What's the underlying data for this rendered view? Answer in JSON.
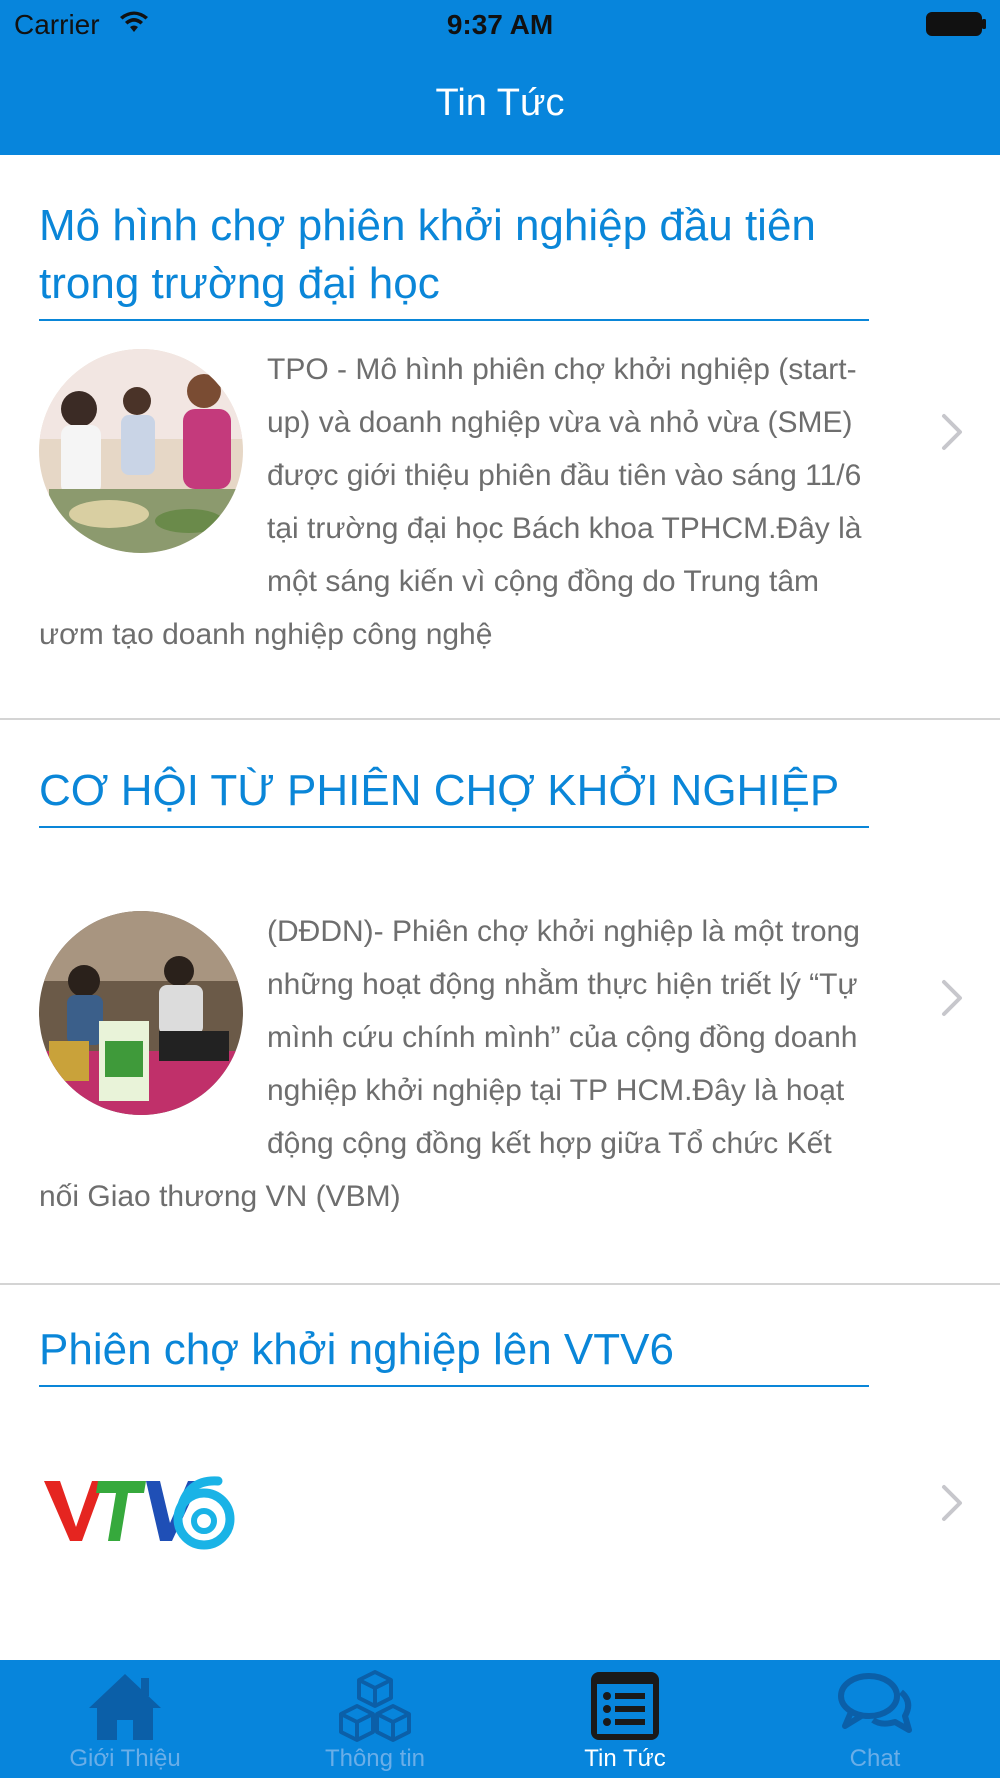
{
  "status_bar": {
    "carrier": "Carrier",
    "time": "9:37 AM"
  },
  "nav": {
    "title": "Tin Tức"
  },
  "news": [
    {
      "title": "Mô hình chợ phiên khởi nghiệp đầu tiên trong trường đại học",
      "summary": "TPO - Mô hình phiên chợ khởi nghiệp (start-up) và doanh nghiệp vừa và nhỏ vừa (SME) được giới thiệu phiên đầu tiên vào sáng 11/6 tại trường đại học Bách khoa TPHCM.Đây là một sáng kiến vì cộng đồng do Trung tâm ươm tạo doanh nghiệp công nghệ"
    },
    {
      "title": "CƠ HỘI TỪ PHIÊN CHỢ KHỞI NGHIỆP",
      "summary": "(DĐDN)- Phiên chợ khởi nghiệp là một trong những hoạt động nhằm thực hiện triết lý “Tự mình cứu chính mình” của cộng đồng doanh nghiệp khởi nghiệp tại TP HCM.Đây là hoạt động cộng đồng kết hợp giữa Tổ chức Kết nối Giao thương VN (VBM)"
    },
    {
      "title": "Phiên chợ khởi nghiệp lên VTV6",
      "summary": ""
    }
  ],
  "tabs": [
    {
      "label": "Giới Thiệu",
      "icon": "home-icon"
    },
    {
      "label": "Thông tin",
      "icon": "cubes-icon"
    },
    {
      "label": "Tin Tức",
      "icon": "news-list-icon",
      "active": true
    },
    {
      "label": "Chat",
      "icon": "chat-bubbles-icon"
    }
  ],
  "colors": {
    "primary": "#0785dc",
    "title_blue": "#0a86d8",
    "body_gray": "#6e6e6e",
    "separator": "#d4d4d4",
    "inactive_tab": "#6aaee8",
    "active_tab_icon": "#1a1a1a"
  }
}
